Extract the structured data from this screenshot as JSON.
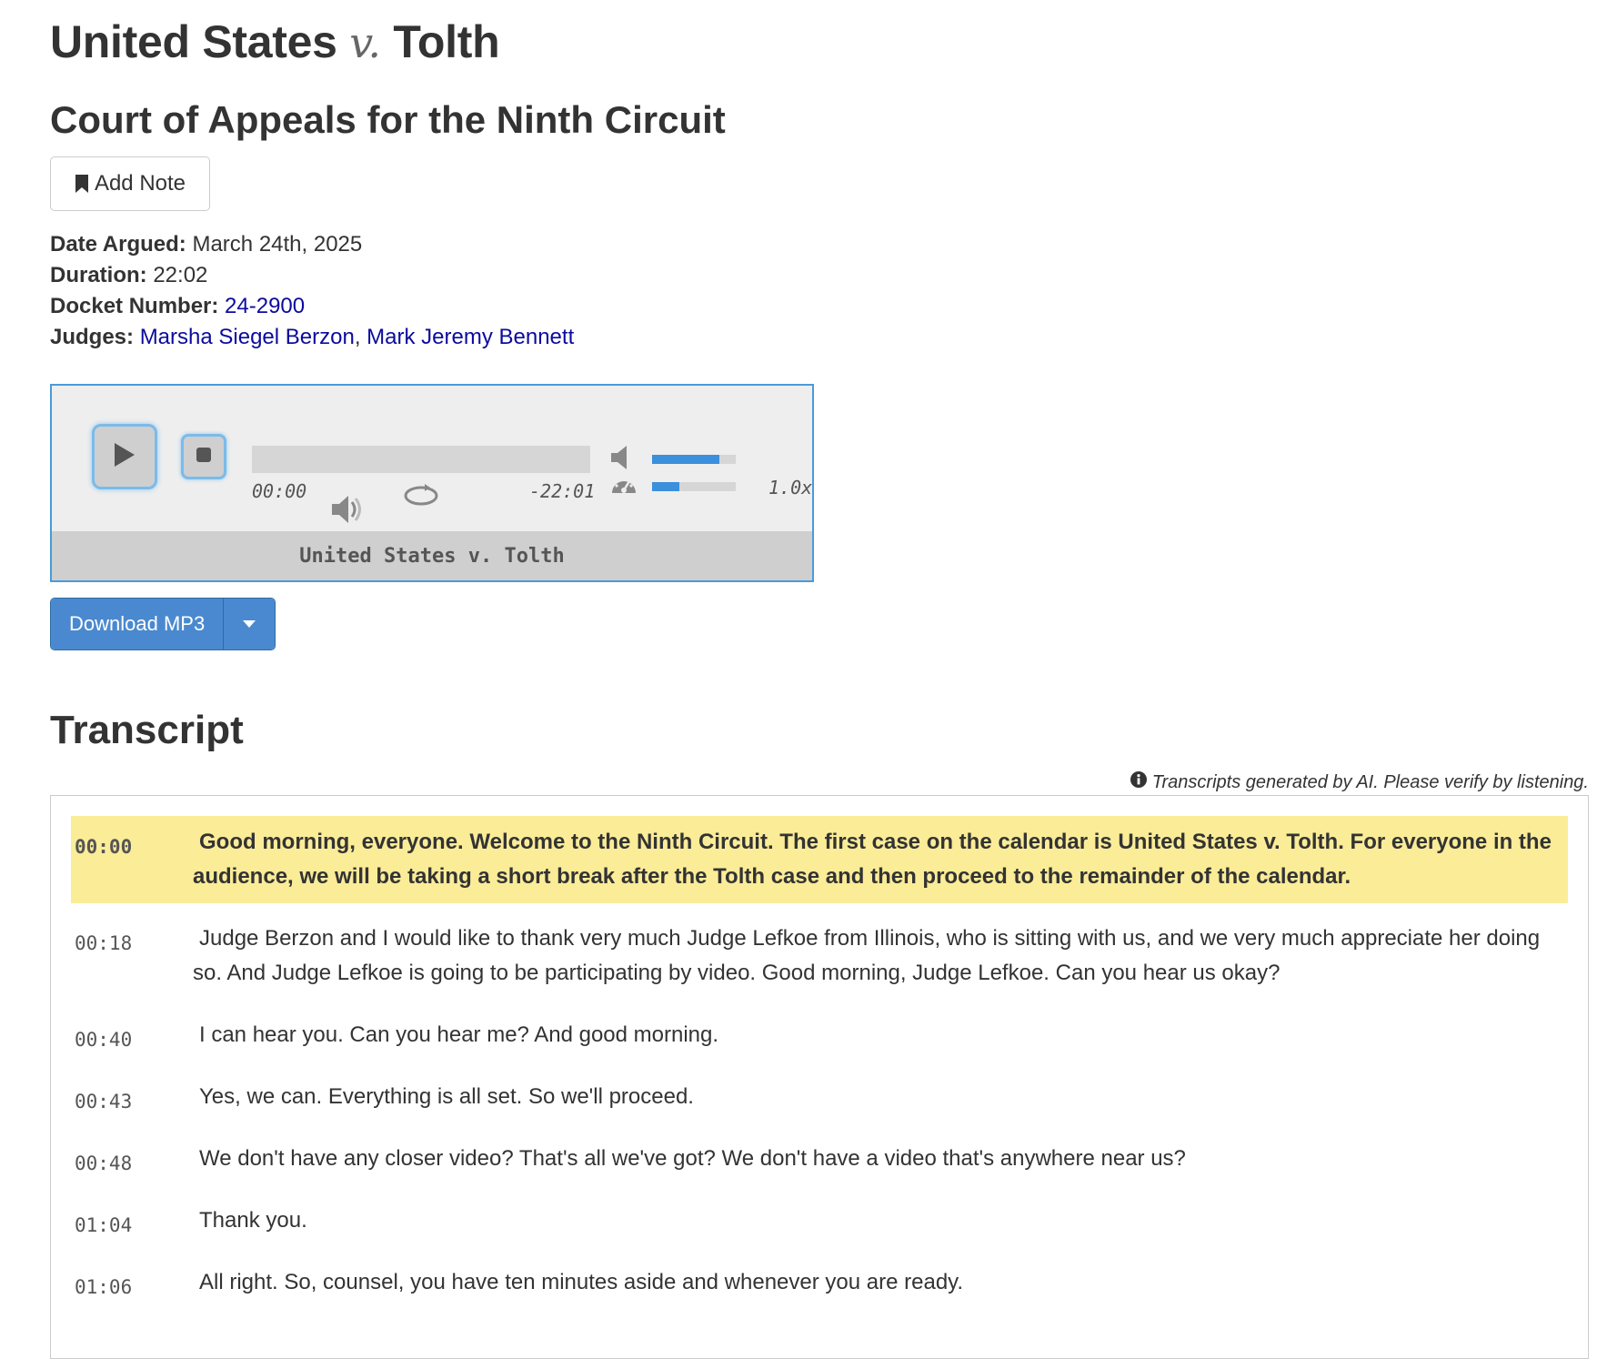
{
  "case": {
    "title_part1": "United States",
    "title_v": "v.",
    "title_part2": "Tolth",
    "court": "Court of Appeals for the Ninth Circuit"
  },
  "actions": {
    "add_note_label": "Add Note",
    "download_label": "Download MP3"
  },
  "meta": {
    "date_label": "Date Argued:",
    "date_value": "March 24th, 2025",
    "duration_label": "Duration:",
    "duration_value": "22:02",
    "docket_label": "Docket Number:",
    "docket_value": "24-2900",
    "judges_label": "Judges:",
    "judges": [
      "Marsha Siegel Berzon",
      "Mark Jeremy Bennett"
    ],
    "judge_separator": ","
  },
  "player": {
    "current_time": "00:00",
    "remaining_time": "-22:01",
    "playback_rate": "1.0x",
    "title": "United States v. Tolth",
    "volume_level": 0.8,
    "speed_level": 0.33,
    "progress": 0
  },
  "transcript": {
    "heading": "Transcript",
    "disclaimer": "Transcripts generated by AI. Please verify by listening.",
    "lines": [
      {
        "time": "00:00",
        "text": "Good morning, everyone. Welcome to the Ninth Circuit. The first case on the calendar is United States v. Tolth. For everyone in the audience, we will be taking a short break after the Tolth case and then proceed to the remainder of the calendar.",
        "active": true
      },
      {
        "time": "00:18",
        "text": "Judge Berzon and I would like to thank very much Judge Lefkoe from Illinois, who is sitting with us, and we very much appreciate her doing so. And Judge Lefkoe is going to be participating by video. Good morning, Judge Lefkoe. Can you hear us okay?",
        "active": false
      },
      {
        "time": "00:40",
        "text": "I can hear you. Can you hear me? And good morning.",
        "active": false
      },
      {
        "time": "00:43",
        "text": "Yes, we can. Everything is all set. So we'll proceed.",
        "active": false
      },
      {
        "time": "00:48",
        "text": "We don't have any closer video? That's all we've got? We don't have a video that's anywhere near us?",
        "active": false
      },
      {
        "time": "01:04",
        "text": "Thank you.",
        "active": false
      },
      {
        "time": "01:06",
        "text": "All right. So, counsel, you have ten minutes aside and whenever you are ready.",
        "active": false
      }
    ]
  },
  "colors": {
    "link": "#0b0b9e",
    "highlight": "#fbec98",
    "accent_blue": "#4a89cf",
    "player_border": "#4a9ad9"
  },
  "icons": {
    "add_note": "bookmark-icon",
    "play": "play-icon",
    "stop": "stop-icon",
    "volume": "volume-icon",
    "speed": "speedometer-icon",
    "mute": "mute-icon",
    "loop": "loop-icon",
    "dropdown": "caret-down-icon",
    "info": "info-icon"
  }
}
